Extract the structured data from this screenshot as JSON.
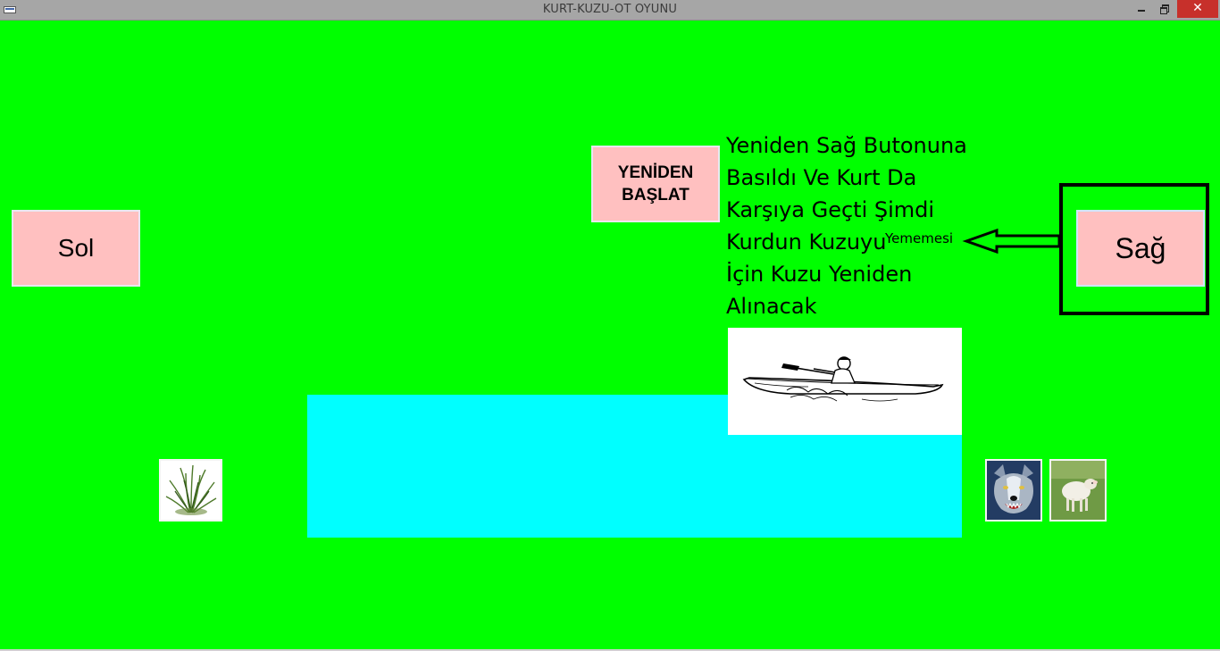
{
  "window": {
    "title": "KURT-KUZU-OT OYUNU",
    "close_glyph": "✕",
    "background_color": "#00ff00"
  },
  "buttons": {
    "sol_label": "Sol",
    "restart_label": "YENİDEN\nBAŞLAT",
    "sag_label": "Sağ",
    "button_color": "#ffc0c0"
  },
  "message": {
    "lines": [
      "Yeniden Sağ Butonuna",
      "Basıldı Ve Kurt Da",
      "Karşıya Geçti Şimdi",
      "Kurdun Kuzuyu",
      "İçin Kuzu Yeniden",
      "Alınacak"
    ]
  },
  "annotation": {
    "label": "Yememesi"
  },
  "scene": {
    "river_color": "#00ffff",
    "images": {
      "boat": "kayak-boat-image",
      "grass": "grass-image",
      "wolf": "wolf-image",
      "lamb": "lamb-image"
    }
  }
}
